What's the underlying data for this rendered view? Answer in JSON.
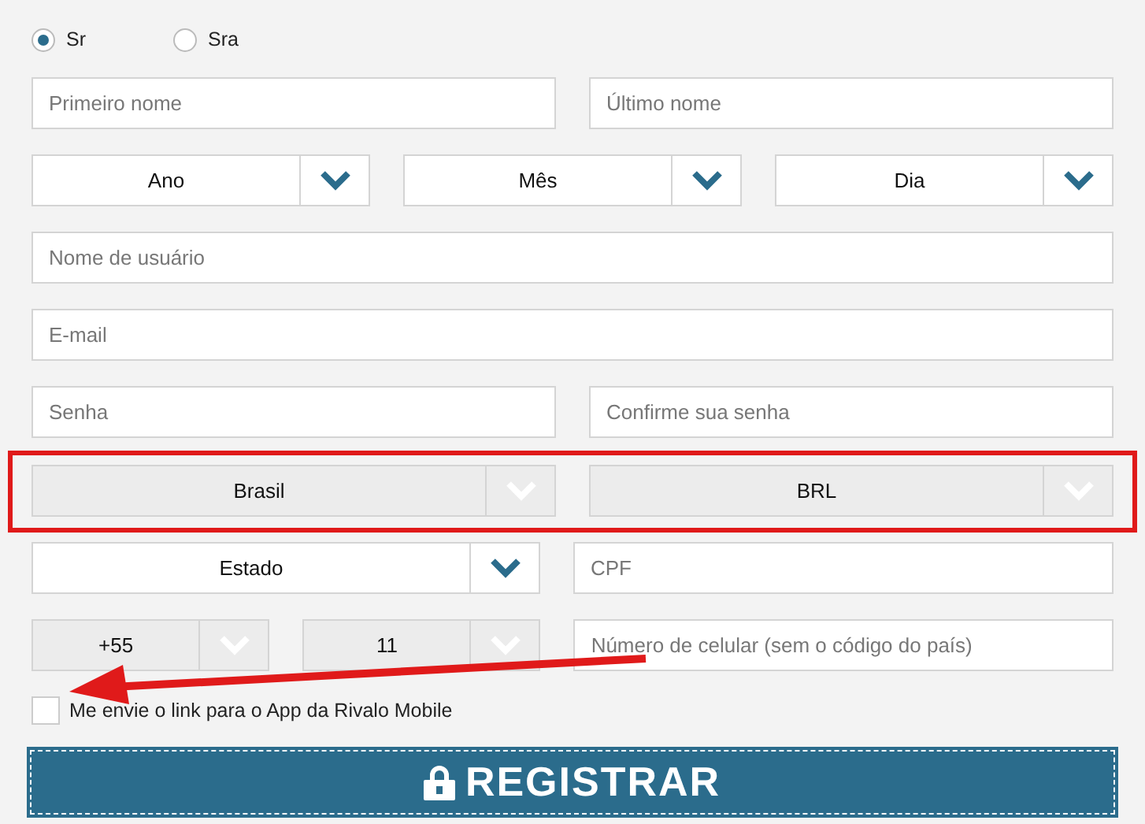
{
  "gender": [
    {
      "label": "Sr",
      "selected": true
    },
    {
      "label": "Sra",
      "selected": false
    }
  ],
  "rows": [
    {
      "highlighted": false,
      "items": [
        {
          "kind": "input",
          "placeholder": "Primeiro nome"
        },
        {
          "kind": "input",
          "placeholder": "Último nome"
        }
      ]
    },
    {
      "highlighted": false,
      "items": [
        {
          "kind": "select",
          "value": "Ano",
          "disabled": false
        },
        {
          "kind": "select",
          "value": "Mês",
          "disabled": false
        },
        {
          "kind": "select",
          "value": "Dia",
          "disabled": false
        }
      ]
    },
    {
      "highlighted": false,
      "items": [
        {
          "kind": "input",
          "placeholder": "Nome de usuário"
        }
      ]
    },
    {
      "highlighted": false,
      "items": [
        {
          "kind": "input",
          "placeholder": "E-mail"
        }
      ]
    },
    {
      "highlighted": false,
      "items": [
        {
          "kind": "input",
          "placeholder": "Senha"
        },
        {
          "kind": "input",
          "placeholder": "Confirme sua senha"
        }
      ]
    },
    {
      "highlighted": true,
      "items": [
        {
          "kind": "select",
          "value": "Brasil",
          "disabled": true
        },
        {
          "kind": "select",
          "value": "BRL",
          "disabled": true
        }
      ]
    },
    {
      "highlighted": false,
      "items": [
        {
          "kind": "select",
          "value": "Estado",
          "disabled": false
        },
        {
          "kind": "input",
          "placeholder": "CPF"
        }
      ]
    }
  ],
  "phone": {
    "country_code": {
      "value": "+55",
      "disabled": true
    },
    "area_code": {
      "value": "11",
      "disabled": true
    },
    "number": {
      "placeholder": "Número de celular (sem o código do país)"
    }
  },
  "app_link": {
    "label": "Me envie o link para o App da Rivalo Mobile",
    "checked": false
  },
  "submit": {
    "label": "REGISTRAR"
  }
}
